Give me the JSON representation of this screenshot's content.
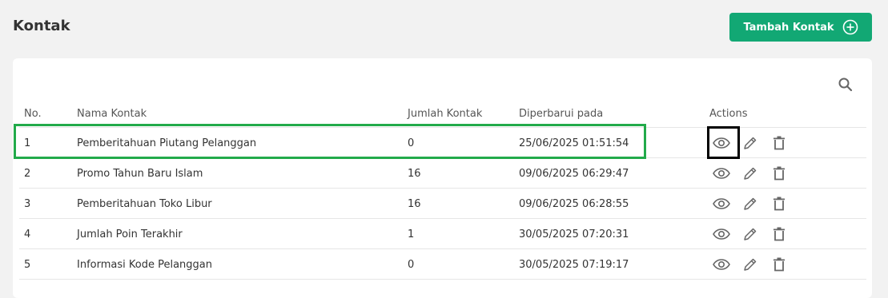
{
  "header": {
    "title": "Kontak",
    "add_button_label": "Tambah Kontak"
  },
  "table": {
    "columns": {
      "no": "No.",
      "name": "Nama Kontak",
      "count": "Jumlah Kontak",
      "updated": "Diperbarui pada",
      "actions": "Actions"
    },
    "rows": [
      {
        "no": "1",
        "name": "Pemberitahuan Piutang Pelanggan",
        "count": "0",
        "updated": "25/06/2025 01:51:54"
      },
      {
        "no": "2",
        "name": "Promo Tahun Baru Islam",
        "count": "16",
        "updated": "09/06/2025 06:29:47"
      },
      {
        "no": "3",
        "name": "Pemberitahuan Toko Libur",
        "count": "16",
        "updated": "09/06/2025 06:28:55"
      },
      {
        "no": "4",
        "name": "Jumlah Poin Terakhir",
        "count": "1",
        "updated": "30/05/2025 07:20:31"
      },
      {
        "no": "5",
        "name": "Informasi Kode Pelanggan",
        "count": "0",
        "updated": "30/05/2025 07:19:17"
      }
    ]
  },
  "icons": {
    "add": "plus-circle-icon",
    "search": "search-icon",
    "view": "eye-icon",
    "edit": "pencil-icon",
    "delete": "trash-icon"
  },
  "colors": {
    "primary": "#12a874",
    "highlight_row": "#22aa4a",
    "highlight_action": "#000000"
  }
}
